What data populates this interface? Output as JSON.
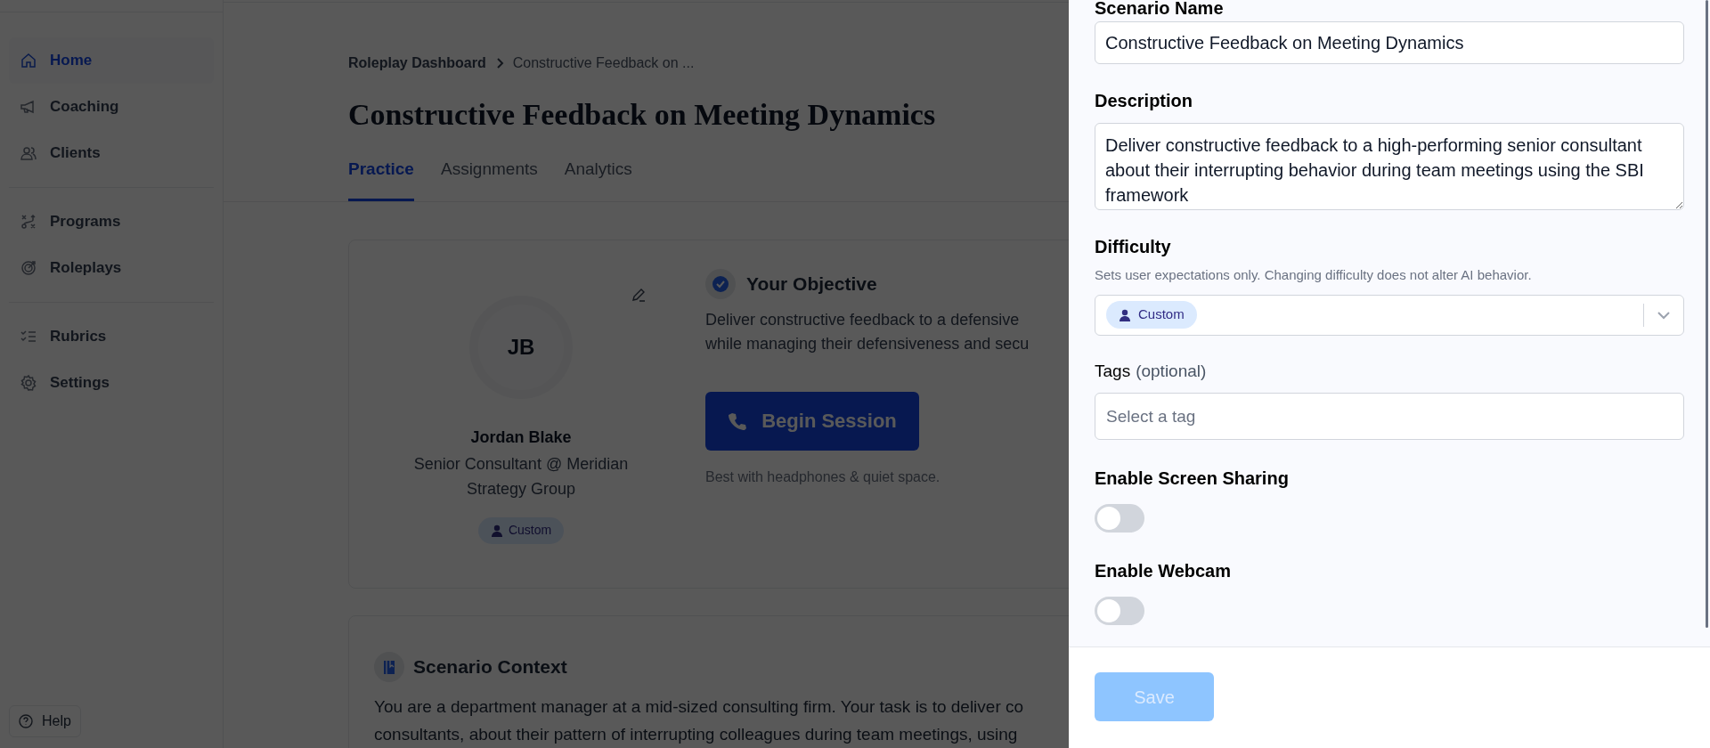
{
  "sidebar": {
    "sections": [
      {
        "items": [
          {
            "label": "Home",
            "kind": "home",
            "selected": true
          },
          {
            "label": "Coaching",
            "kind": "coaching",
            "selected": false
          },
          {
            "label": "Clients",
            "kind": "clients",
            "selected": false
          }
        ]
      },
      {
        "items": [
          {
            "label": "Programs",
            "kind": "programs",
            "selected": false
          },
          {
            "label": "Roleplays",
            "kind": "roleplays",
            "selected": false
          }
        ]
      },
      {
        "items": [
          {
            "label": "Rubrics",
            "kind": "rubrics",
            "selected": false
          },
          {
            "label": "Settings",
            "kind": "settings",
            "selected": false
          }
        ]
      }
    ],
    "help_button": "Help"
  },
  "breadcrumb": [
    "Roleplay Dashboard",
    "Constructive Feedback on ..."
  ],
  "title": "Constructive Feedback on Meeting Dynamics",
  "tabs": [
    {
      "label": "Practice",
      "selected": true
    },
    {
      "label": "Assignments",
      "selected": false
    },
    {
      "label": "Analytics",
      "selected": false
    }
  ],
  "persona": {
    "initials": "JB",
    "name": "Jordan Blake",
    "role": "Senior Consultant @ Meridian Strategy Group",
    "badge": "Custom"
  },
  "objective": {
    "heading": "Your Objective",
    "lines": [
      "Deliver constructive feedback to a defensive",
      "while managing their defensiveness and secu"
    ]
  },
  "begin_button": "Begin Session",
  "begin_hint": "Best with headphones & quiet space.",
  "context": {
    "heading": "Scenario Context",
    "lines": [
      "You are a department manager at a mid-sized consulting firm. Your task is to deliver co",
      "consultants, about their pattern of interrupting colleagues during team meetings, using"
    ]
  },
  "panel": {
    "fields": [
      {
        "kind": "text",
        "label": "Scenario Name",
        "value": "Constructive Feedback on Meeting Dynamics"
      },
      {
        "kind": "textarea",
        "label": "Description",
        "value": "Deliver constructive feedback to a high-performing senior consultant about their interrupting behavior during team meetings using the SBI framework"
      },
      {
        "kind": "select",
        "label": "Difficulty",
        "hint": "Sets user expectations only. Changing difficulty does not alter AI behavior.",
        "value": "Custom"
      },
      {
        "kind": "tags",
        "label": "Tags",
        "note": "(optional)",
        "placeholder": "Select a tag"
      },
      {
        "kind": "toggle",
        "label": "Enable Screen Sharing",
        "on": false
      },
      {
        "kind": "toggle",
        "label": "Enable Webcam",
        "on": false
      }
    ],
    "save_button": {
      "label": "Save",
      "disabled": true
    }
  }
}
